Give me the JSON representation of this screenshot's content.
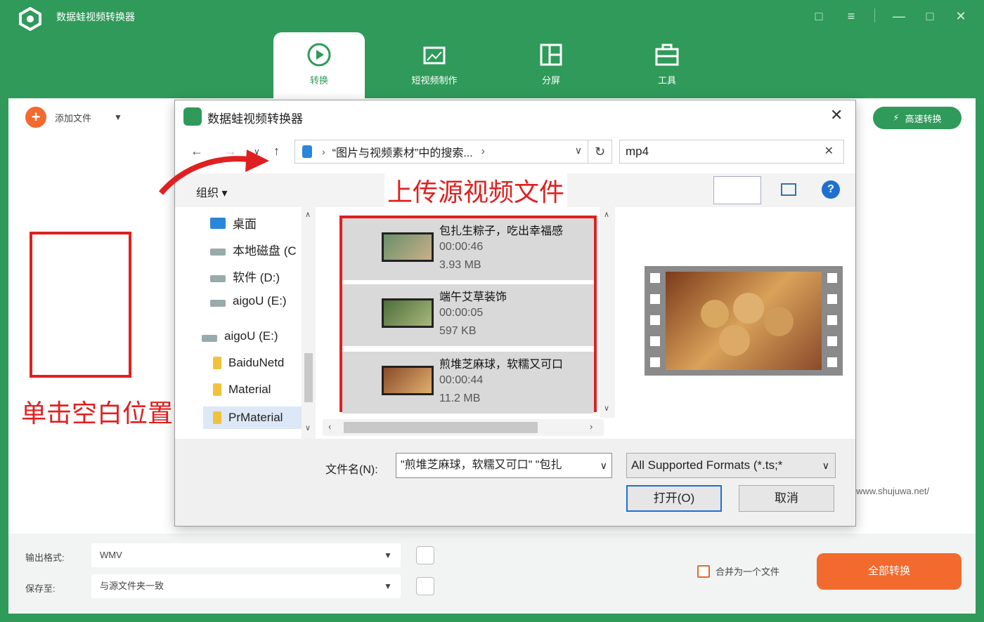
{
  "app": {
    "title": "数据蛙视频转换器",
    "brand_color": "#2f9a5a",
    "accent_color": "#f26a2e"
  },
  "window_controls": [
    "feedback-icon",
    "menu-icon",
    "minimize-icon",
    "maximize-icon",
    "close-icon"
  ],
  "tabs": [
    {
      "label": "转换",
      "icon": "convert-icon",
      "active": true
    },
    {
      "label": "短视频制作",
      "icon": "video-maker-icon",
      "active": false
    },
    {
      "label": "分屏",
      "icon": "split-screen-icon",
      "active": false
    },
    {
      "label": "工具",
      "icon": "toolbox-icon",
      "active": false
    }
  ],
  "main": {
    "add_file_label": "添加文件",
    "fast_convert_label": "高速转换",
    "watermark": "www.shujuwa.net/",
    "annotation_click_blank": "单击空白位置"
  },
  "bottom": {
    "output_format_label": "输出格式:",
    "output_format_value": "WMV",
    "save_to_label": "保存至:",
    "save_to_value": "与源文件夹一致",
    "merge_label": "合并为一个文件",
    "convert_all_label": "全部转换"
  },
  "dialog": {
    "title": "数据蛙视频转换器",
    "address": "“图片与视频素材”中的搜索...",
    "search_value": "mp4",
    "organize_label": "组织",
    "annotation_upload": "上传源视频文件",
    "nav_items": [
      {
        "label": "桌面",
        "type": "desktop"
      },
      {
        "label": "本地磁盘 (C",
        "type": "drive"
      },
      {
        "label": "软件 (D:)",
        "type": "drive"
      },
      {
        "label": "aigoU (E:)",
        "type": "drive"
      },
      {
        "label": "aigoU (E:)",
        "type": "drive"
      },
      {
        "label": "BaiduNetd",
        "type": "folder"
      },
      {
        "label": "Material",
        "type": "folder"
      },
      {
        "label": "PrMaterial",
        "type": "folder",
        "selected": true
      }
    ],
    "files": [
      {
        "name": "包扎生粽子，吃出幸福感",
        "duration": "00:00:46",
        "size": "3.93 MB"
      },
      {
        "name": "端午艾草装饰",
        "duration": "00:00:05",
        "size": "597 KB"
      },
      {
        "name": "煎堆芝麻球，软糯又可口",
        "duration": "00:00:44",
        "size": "11.2 MB"
      }
    ],
    "filename_label": "文件名(N):",
    "filename_value": "\"煎堆芝麻球，软糯又可口\" \"包扎",
    "format_value": "All Supported Formats (*.ts;*",
    "open_label": "打开(O)",
    "cancel_label": "取消"
  }
}
